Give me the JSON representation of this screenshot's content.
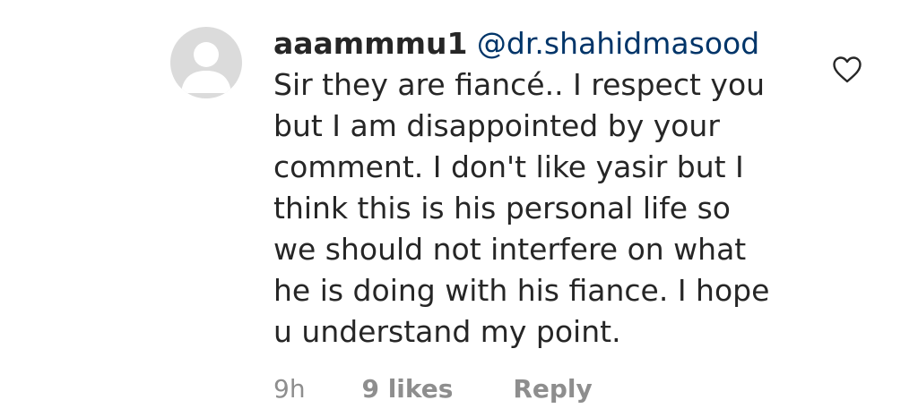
{
  "comment": {
    "username": "aaammmu1",
    "mention": "@dr.shahidmasood",
    "lines": [
      "Sir they are fiancé.. I respect you",
      "but I am disappointed by your",
      "comment. I don't like yasir but I",
      "think this is his personal life so",
      "we should not interfere on what",
      "he is doing with his fiance. I hope",
      "u understand my point."
    ],
    "time": "9h",
    "likes": "9 likes",
    "reply_label": "Reply",
    "icons": {
      "avatar": "default-user-avatar",
      "like": "heart-outline-icon"
    },
    "colors": {
      "text": "#262626",
      "mention": "#003569",
      "meta": "#8e8e8e",
      "avatar_bg": "#dbdbdb"
    }
  }
}
